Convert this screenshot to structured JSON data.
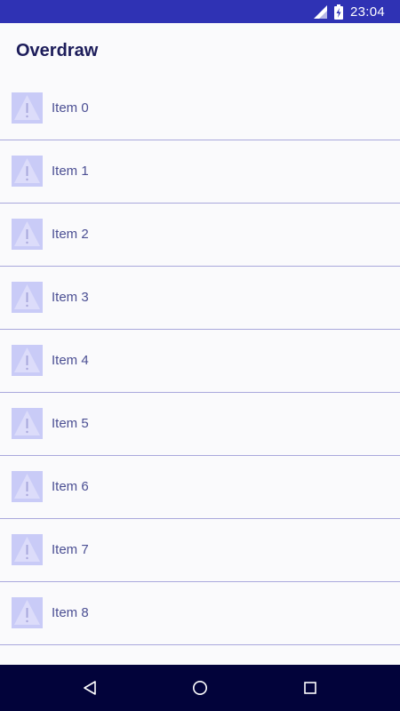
{
  "status_bar": {
    "time": "23:04",
    "icons": [
      "cell-signal-icon",
      "battery-charging-icon"
    ]
  },
  "app_bar": {
    "title": "Overdraw"
  },
  "list": {
    "items": [
      {
        "label": "Item 0",
        "icon": "image-placeholder-icon"
      },
      {
        "label": "Item 1",
        "icon": "image-placeholder-icon"
      },
      {
        "label": "Item 2",
        "icon": "image-placeholder-icon"
      },
      {
        "label": "Item 3",
        "icon": "image-placeholder-icon"
      },
      {
        "label": "Item 4",
        "icon": "image-placeholder-icon"
      },
      {
        "label": "Item 5",
        "icon": "image-placeholder-icon"
      },
      {
        "label": "Item 6",
        "icon": "image-placeholder-icon"
      },
      {
        "label": "Item 7",
        "icon": "image-placeholder-icon"
      },
      {
        "label": "Item 8",
        "icon": "image-placeholder-icon"
      }
    ]
  },
  "nav_bar": {
    "buttons": [
      "back-icon",
      "home-icon",
      "recents-icon"
    ]
  },
  "colors": {
    "status_bar": "#2f32b4",
    "background": "#fafafc",
    "divider": "#a9a8dc",
    "item_text": "#4b4f93",
    "title_text": "#1c1c5a",
    "icon_tint": "#c9cbf7",
    "nav_bar": "#02033a"
  }
}
